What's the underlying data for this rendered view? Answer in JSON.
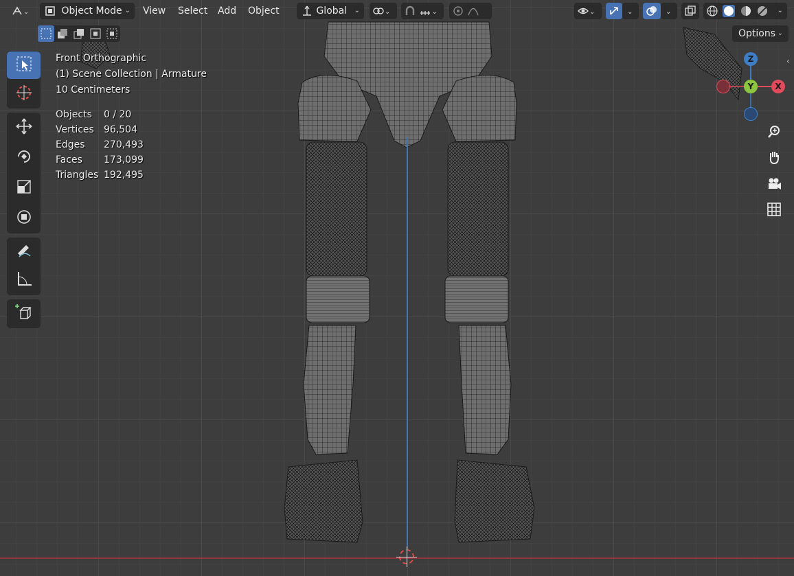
{
  "header": {
    "mode_label": "Object Mode",
    "menus": [
      "View",
      "Select",
      "Add",
      "Object"
    ],
    "orientation_label": "Global",
    "options_label": "Options"
  },
  "viewport_info": {
    "view_name": "Front Orthographic",
    "collection": "(1) Scene Collection | Armature",
    "scale": "10 Centimeters"
  },
  "stats": [
    {
      "label": "Objects",
      "value": "0 / 20"
    },
    {
      "label": "Vertices",
      "value": "96,504"
    },
    {
      "label": "Edges",
      "value": "270,493"
    },
    {
      "label": "Faces",
      "value": "173,099"
    },
    {
      "label": "Triangles",
      "value": "192,495"
    }
  ],
  "gizmo": {
    "z": "Z",
    "y": "Y",
    "x": "X"
  },
  "colors": {
    "accent": "#4772b3",
    "panel": "#2b2b2b",
    "axis_x": "#e04a5a",
    "axis_y": "#8cc63f",
    "axis_z": "#3f7ec7"
  },
  "icons": [
    "editor-type-icon",
    "object-mode-icon",
    "transform-orientation-icon",
    "pivot-icon",
    "snap-icon",
    "snap-increment-icon",
    "proportional-edit-icon",
    "falloff-icon",
    "visibility-icon",
    "gizmo-icon",
    "overlay-icon",
    "xray-icon",
    "wireframe-shading-icon",
    "solid-shading-icon",
    "material-shading-icon",
    "rendered-shading-icon",
    "select-box-icon",
    "cursor-icon",
    "move-icon",
    "rotate-icon",
    "scale-icon",
    "transform-icon",
    "annotate-icon",
    "measure-icon",
    "add-cube-icon",
    "zoom-icon",
    "hand-icon",
    "camera-icon",
    "grid-icon"
  ]
}
